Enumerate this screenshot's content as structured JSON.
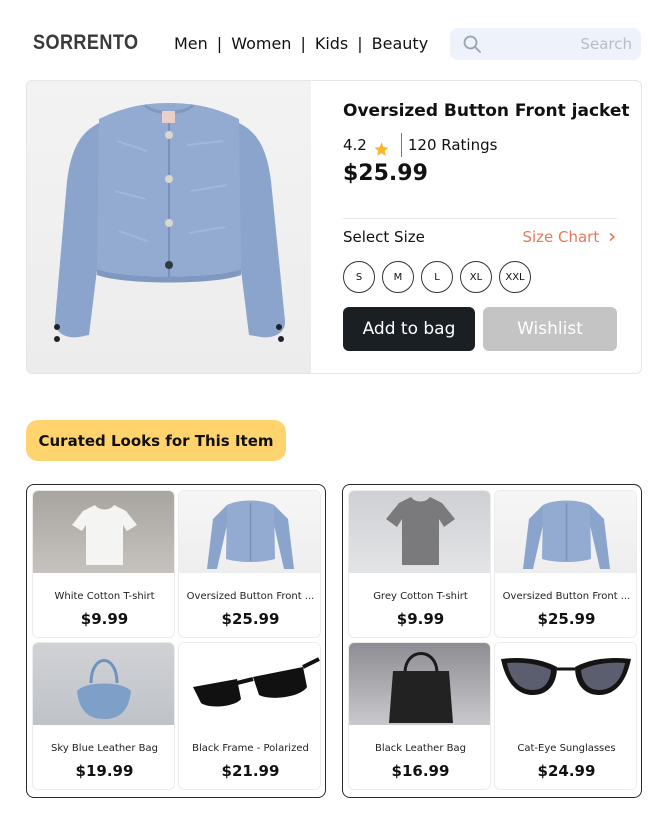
{
  "brand": {
    "logo": "SORRENTO"
  },
  "nav": {
    "items": [
      "Men",
      "Women",
      "Kids",
      "Beauty"
    ],
    "separator": "|"
  },
  "search": {
    "placeholder": "Search",
    "value": "",
    "icon": "search-icon"
  },
  "product": {
    "title": "Oversized Button Front jacket",
    "rating": "4.2",
    "ratings_count": "120 Ratings",
    "price": "$25.99",
    "size_label": "Select Size",
    "size_chart_label": "Size Chart",
    "size_chart_icon": "chevron-right-icon",
    "sizes": [
      "S",
      "M",
      "L",
      "XL",
      "XXL"
    ],
    "add_to_bag_label": "Add to bag",
    "wishlist_label": "Wishlist"
  },
  "curated": {
    "heading": "Curated Looks for This Item",
    "looks": [
      {
        "items": [
          {
            "name": "White Cotton T-shirt",
            "price": "$9.99"
          },
          {
            "name": "Oversized Button Front ...",
            "price": "$25.99"
          },
          {
            "name": "Sky Blue Leather Bag",
            "price": "$19.99"
          },
          {
            "name": "Black Frame - Polarized",
            "price": "$21.99"
          }
        ]
      },
      {
        "items": [
          {
            "name": "Grey Cotton T-shirt",
            "price": "$9.99"
          },
          {
            "name": "Oversized Button Front ...",
            "price": "$25.99"
          },
          {
            "name": "Black Leather Bag",
            "price": "$16.99"
          },
          {
            "name": "Cat-Eye Sunglasses",
            "price": "$24.99"
          }
        ]
      }
    ]
  },
  "colors": {
    "accent": "#e8785a",
    "primary_button": "#1a1f24",
    "disabled_button": "#c4c4c4",
    "highlight": "#ffd36e",
    "search_bg": "#eef3fb",
    "jacket": "#8fa9cf",
    "star": "#f5b82e"
  }
}
